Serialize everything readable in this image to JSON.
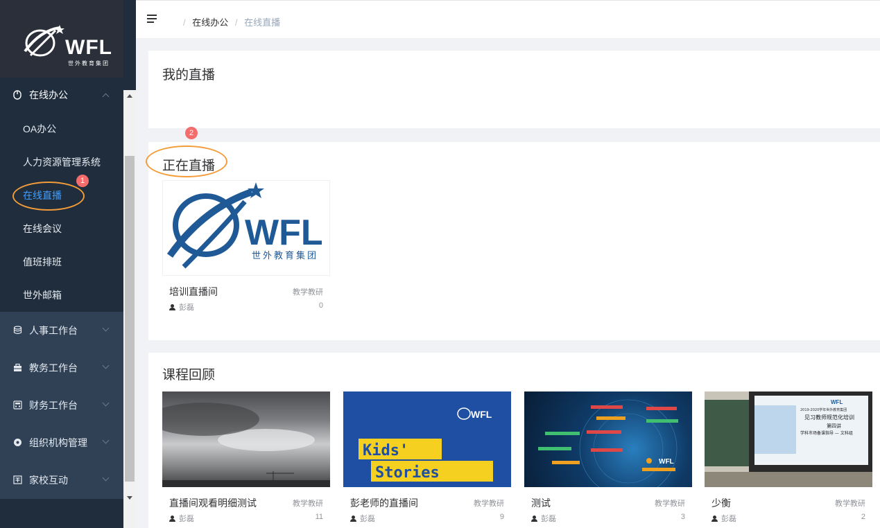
{
  "brand": {
    "logo_text": "WFL",
    "logo_sub": "世外教育集团"
  },
  "sidebar": {
    "groups": [
      {
        "label": "在线办公",
        "icon": "mouse-icon",
        "open": true
      },
      {
        "label": "人事工作台",
        "icon": "database-icon"
      },
      {
        "label": "教务工作台",
        "icon": "briefcase-icon"
      },
      {
        "label": "财务工作台",
        "icon": "calculator-icon"
      },
      {
        "label": "组织机构管理",
        "icon": "gear-icon"
      },
      {
        "label": "家校互动",
        "icon": "school-icon"
      }
    ],
    "sub_items": [
      {
        "label": "OA办公"
      },
      {
        "label": "人力资源管理系统"
      },
      {
        "label": "在线直播",
        "active": true
      },
      {
        "label": "在线会议"
      },
      {
        "label": "值班排班"
      },
      {
        "label": "世外邮箱"
      }
    ]
  },
  "breadcrumb": {
    "parent": "在线办公",
    "current": "在线直播",
    "separator": "/"
  },
  "sections": {
    "my_live": {
      "title": "我的直播"
    },
    "live_now": {
      "title": "正在直播"
    },
    "review": {
      "title": "课程回顾"
    }
  },
  "live_now_cards": [
    {
      "name": "培训直播间",
      "category": "教学教研",
      "owner": "彭磊",
      "count": "0"
    }
  ],
  "review_cards": [
    {
      "name": "直播间观看明细测试",
      "category": "教学教研",
      "owner": "彭磊",
      "count": "11"
    },
    {
      "name": "彭老师的直播间",
      "category": "教学教研",
      "owner": "彭磊",
      "count": "9"
    },
    {
      "name": "测试",
      "category": "教学教研",
      "owner": "彭磊",
      "count": "3"
    },
    {
      "name": "少衡",
      "category": "教学教研",
      "owner": "彭磊",
      "count": "2"
    }
  ],
  "thumb_text": {
    "kids_top": "Kids'",
    "kids_bottom": "Stories",
    "slide_line1": "2019-2020学年世外教育集团",
    "slide_line2": "见习教师规范化培训",
    "slide_line3": "第四讲",
    "slide_line4": "学科市场备课指导 — 文科组"
  },
  "annotations": {
    "badge1": "1",
    "badge2": "2"
  },
  "colors": {
    "sidebar_bg": "#1f2d3d",
    "active": "#409eff",
    "badge": "#f56c6c",
    "ring": "#f39c38",
    "brand_blue": "#1f5a96"
  }
}
